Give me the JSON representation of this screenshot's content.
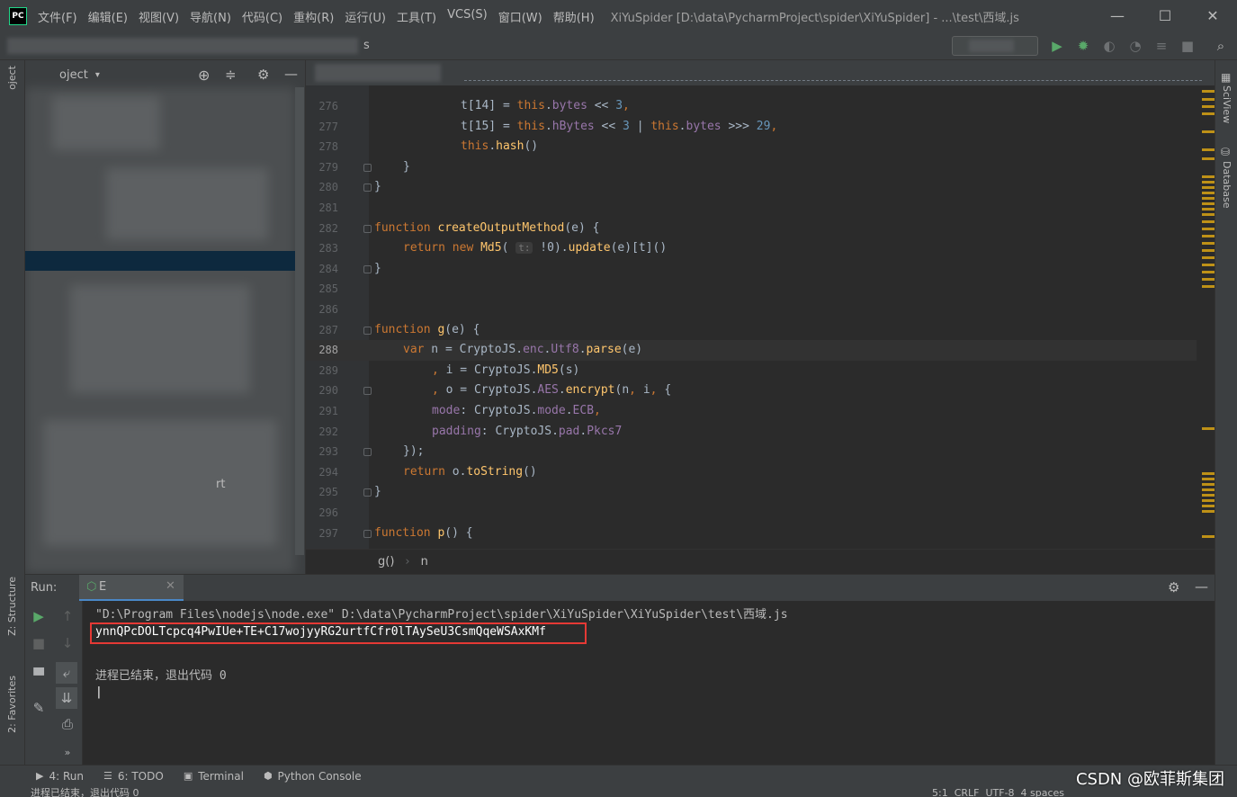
{
  "app": {
    "logo_text": "PC",
    "menu": [
      "文件(F)",
      "编辑(E)",
      "视图(V)",
      "导航(N)",
      "代码(C)",
      "重构(R)",
      "运行(U)",
      "工具(T)",
      "VCS(S)",
      "窗口(W)",
      "帮助(H)"
    ],
    "window_title": "XiYuSpider [D:\\data\\PycharmProject\\spider\\XiYuSpider] - ...\\test\\西域.js",
    "minimize_glyph": "—",
    "maximize_glyph": "☐",
    "close_glyph": "✕"
  },
  "navbar": {
    "partial_text": "s"
  },
  "project_panel": {
    "title": "oject",
    "dropdown": "▾",
    "partial_text": "rt"
  },
  "left_strip": {
    "project_label": "oject",
    "structure_label": "Z: Structure",
    "favorites_label": "2: Favorites"
  },
  "right_strip": {
    "sciview_label": "SciView",
    "database_label": "Database"
  },
  "editor": {
    "lines": [
      {
        "n": "276",
        "tokens": [
          [
            "t[14] = ",
            ""
          ],
          [
            "this",
            "kw"
          ],
          [
            ".",
            ""
          ],
          [
            "bytes",
            "prop"
          ],
          [
            " << ",
            ""
          ],
          [
            "3",
            "num"
          ],
          [
            ",",
            "kw"
          ]
        ],
        "indent": 12
      },
      {
        "n": "277",
        "tokens": [
          [
            "t[15] = ",
            ""
          ],
          [
            "this",
            "kw"
          ],
          [
            ".",
            ""
          ],
          [
            "hBytes",
            "prop"
          ],
          [
            " << ",
            ""
          ],
          [
            "3",
            "num"
          ],
          [
            " | ",
            ""
          ],
          [
            "this",
            "kw"
          ],
          [
            ".",
            ""
          ],
          [
            "bytes",
            "prop"
          ],
          [
            " >>> ",
            ""
          ],
          [
            "29",
            "num"
          ],
          [
            ",",
            "kw"
          ]
        ],
        "indent": 12
      },
      {
        "n": "278",
        "tokens": [
          [
            "this",
            "kw"
          ],
          [
            ".",
            ""
          ],
          [
            "hash",
            "fn"
          ],
          [
            "()",
            ""
          ]
        ],
        "indent": 12
      },
      {
        "n": "279",
        "tokens": [
          [
            "}",
            ""
          ]
        ],
        "indent": 4
      },
      {
        "n": "280",
        "tokens": [
          [
            "}",
            ""
          ]
        ],
        "indent": 0
      },
      {
        "n": "281",
        "tokens": [],
        "indent": 0
      },
      {
        "n": "282",
        "tokens": [
          [
            "function ",
            "kw"
          ],
          [
            "createOutputMethod",
            "fn"
          ],
          [
            "(e) {",
            ""
          ]
        ],
        "indent": 0
      },
      {
        "n": "283",
        "tokens": [
          [
            "return new ",
            "kw"
          ],
          [
            "Md5",
            "fn"
          ],
          [
            "( ",
            ""
          ],
          [
            "t:",
            "hint"
          ],
          [
            " !0).",
            ""
          ],
          [
            "update",
            "fn"
          ],
          [
            "(e)[t]()",
            ""
          ]
        ],
        "indent": 4
      },
      {
        "n": "284",
        "tokens": [
          [
            "}",
            ""
          ]
        ],
        "indent": 0
      },
      {
        "n": "285",
        "tokens": [],
        "indent": 0
      },
      {
        "n": "286",
        "tokens": [],
        "indent": 0
      },
      {
        "n": "287",
        "tokens": [
          [
            "function ",
            "kw"
          ],
          [
            "g",
            "fn"
          ],
          [
            "(e) {",
            ""
          ]
        ],
        "indent": 0
      },
      {
        "n": "288",
        "tokens": [
          [
            "var",
            "kw"
          ],
          [
            " n = CryptoJS.",
            ""
          ],
          [
            "enc",
            "prop"
          ],
          [
            ".",
            ""
          ],
          [
            "Utf8",
            "prop"
          ],
          [
            ".",
            ""
          ],
          [
            "parse",
            "fn"
          ],
          [
            "(e)",
            ""
          ]
        ],
        "indent": 4,
        "current": true
      },
      {
        "n": "289",
        "tokens": [
          [
            ", ",
            "kw"
          ],
          [
            "i = CryptoJS.",
            ""
          ],
          [
            "MD5",
            "fn"
          ],
          [
            "(s)",
            ""
          ]
        ],
        "indent": 8
      },
      {
        "n": "290",
        "tokens": [
          [
            ", ",
            "kw"
          ],
          [
            "o = CryptoJS.",
            ""
          ],
          [
            "AES",
            "prop"
          ],
          [
            ".",
            ""
          ],
          [
            "encrypt",
            "fn"
          ],
          [
            "(n",
            ""
          ],
          [
            ", ",
            "kw"
          ],
          [
            "i",
            ""
          ],
          [
            ", ",
            "kw"
          ],
          [
            "{",
            ""
          ]
        ],
        "indent": 8
      },
      {
        "n": "291",
        "tokens": [
          [
            "mode",
            "prop"
          ],
          [
            ": CryptoJS.",
            ""
          ],
          [
            "mode",
            "prop"
          ],
          [
            ".",
            ""
          ],
          [
            "ECB",
            "prop"
          ],
          [
            ",",
            "kw"
          ]
        ],
        "indent": 8
      },
      {
        "n": "292",
        "tokens": [
          [
            "padding",
            "prop"
          ],
          [
            ": CryptoJS.",
            ""
          ],
          [
            "pad",
            "prop"
          ],
          [
            ".",
            ""
          ],
          [
            "Pkcs7",
            "prop"
          ]
        ],
        "indent": 8
      },
      {
        "n": "293",
        "tokens": [
          [
            "});",
            ""
          ]
        ],
        "indent": 4
      },
      {
        "n": "294",
        "tokens": [
          [
            "return ",
            "kw"
          ],
          [
            "o.",
            ""
          ],
          [
            "toString",
            "fn"
          ],
          [
            "()",
            ""
          ]
        ],
        "indent": 4
      },
      {
        "n": "295",
        "tokens": [
          [
            "}",
            ""
          ]
        ],
        "indent": 0
      },
      {
        "n": "296",
        "tokens": [],
        "indent": 0
      },
      {
        "n": "297",
        "tokens": [
          [
            "function ",
            "kw"
          ],
          [
            "p",
            "fn"
          ],
          [
            "() {",
            ""
          ]
        ],
        "indent": 0
      }
    ]
  },
  "breadcrumb": {
    "items": [
      "g()",
      "n"
    ],
    "separator": "›"
  },
  "run": {
    "label": "Run:",
    "tab_label": "E",
    "command": "\"D:\\Program Files\\nodejs\\node.exe\" D:\\data\\PycharmProject\\spider\\XiYuSpider\\XiYuSpider\\test\\西域.js",
    "output": "ynnQPcDOLTcpcq4PwIUe+TE+C17wojyyRG2urtfCfr0lTAySeU3CsmQqeWSAxKMf",
    "exit_message": "进程已结束，退出代码 0",
    "cursor": "|"
  },
  "bottom_tabs": [
    {
      "icon": "▶",
      "label": "4: Run"
    },
    {
      "icon": "☰",
      "label": "6: TODO"
    },
    {
      "icon": "▣",
      "label": "Terminal"
    },
    {
      "icon": "⬢",
      "label": "Python Console"
    }
  ],
  "statusbar": {
    "left": "进程已结束，退出代码 0",
    "right": "5:1  CRLF  UTF-8  4 spaces"
  },
  "watermark": "CSDN @欧菲斯集团",
  "colors": {
    "accent": "#4a88c7",
    "highlight_box": "#e53935",
    "run_green": "#59a869"
  }
}
